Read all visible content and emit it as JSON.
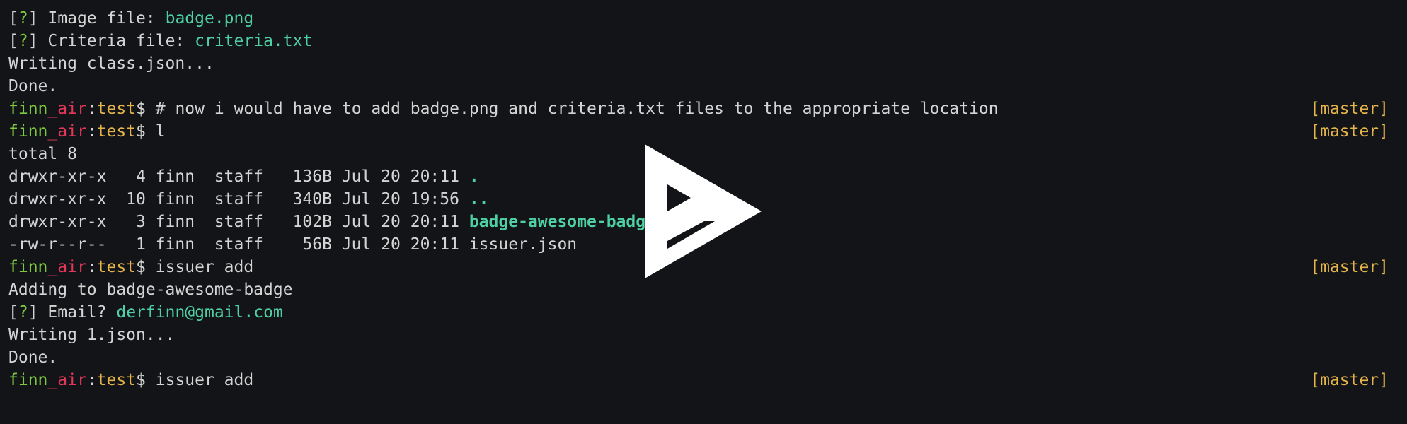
{
  "terminal": {
    "lines": [
      {
        "q_open": "[",
        "q_mark": "?",
        "q_close": "] ",
        "label": "Image file: ",
        "value": "badge.png"
      },
      {
        "q_open": "[",
        "q_mark": "?",
        "q_close": "] ",
        "label": "Criteria file: ",
        "value": "criteria.txt"
      },
      {
        "text": "Writing class.json..."
      },
      {
        "text": "Done."
      },
      {
        "user": "finn",
        "sep": "_",
        "host": "air",
        "colon": ":",
        "dir": "test",
        "prompt": "$ ",
        "cmd": "# now i would have to add badge.png and criteria.txt files to the appropriate location",
        "branch": "[master]"
      },
      {
        "user": "finn",
        "sep": "_",
        "host": "air",
        "colon": ":",
        "dir": "test",
        "prompt": "$ ",
        "cmd": "l",
        "branch": "[master]"
      },
      {
        "text": "total 8"
      },
      {
        "meta": "drwxr-xr-x   4 finn  staff   136B Jul 20 20:11 ",
        "name": "."
      },
      {
        "meta": "drwxr-xr-x  10 finn  staff   340B Jul 20 19:56 ",
        "name": ".."
      },
      {
        "meta": "drwxr-xr-x   3 finn  staff   102B Jul 20 20:11 ",
        "name": "badge-awesome-badge"
      },
      {
        "meta": "-rw-r--r--   1 finn  staff    56B Jul 20 20:11 ",
        "name": "issuer.json"
      },
      {
        "user": "finn",
        "sep": "_",
        "host": "air",
        "colon": ":",
        "dir": "test",
        "prompt": "$ ",
        "cmd": "issuer add",
        "branch": "[master]"
      },
      {
        "text": "Adding to badge-awesome-badge"
      },
      {
        "q_open": "[",
        "q_mark": "?",
        "q_close": "] ",
        "label": "Email? ",
        "value": "derfinn@gmail.com"
      },
      {
        "text": "Writing 1.json..."
      },
      {
        "text": "Done."
      },
      {
        "user": "finn",
        "sep": "_",
        "host": "air",
        "colon": ":",
        "dir": "test",
        "prompt": "$ ",
        "cmd": "issuer add",
        "branch": "[master]"
      }
    ]
  },
  "overlay": {
    "icon": "play-icon",
    "color": "#ffffff"
  }
}
